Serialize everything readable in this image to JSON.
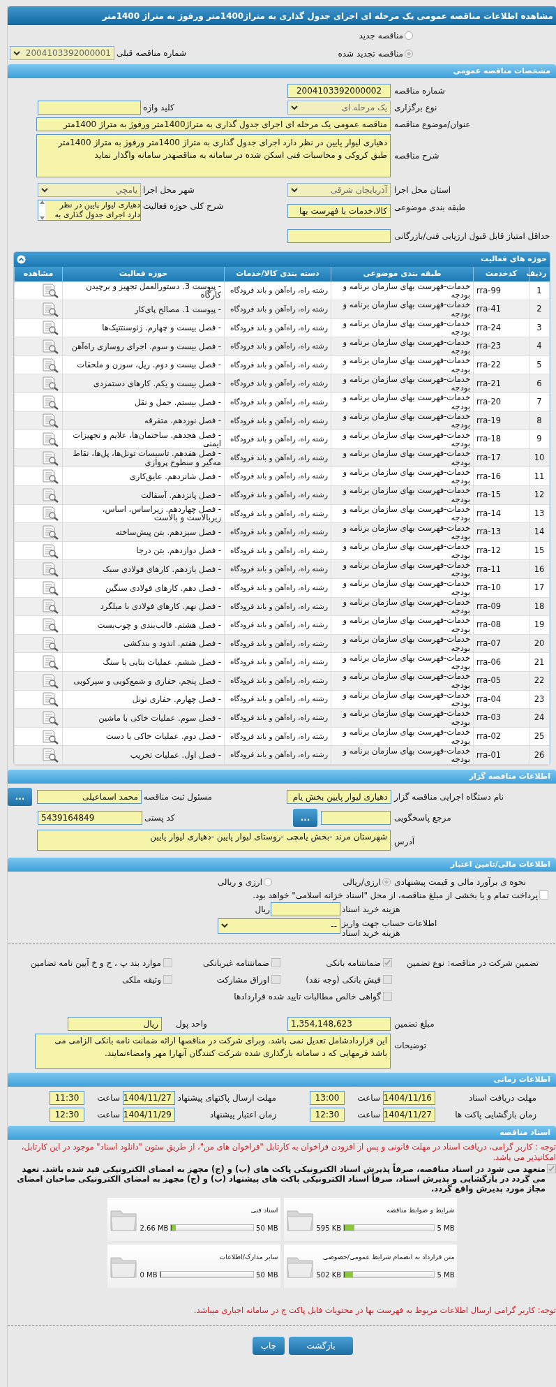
{
  "page_title": "مشاهده اطلاعات مناقصه عمومی یک مرحله ای اجرای جدول گذاری به متراژ1400متر ورفوژ به متراژ 1400متر",
  "tender_type": [
    {
      "label": "مناقصه جدید",
      "selected": false
    },
    {
      "label": "مناقصه تجدید شده",
      "selected": true
    }
  ],
  "previous_tender": {
    "label": "شماره مناقصه قبلی",
    "value": "2004103392000001"
  },
  "general": {
    "title": "مشخصات مناقصه عمومی",
    "tender_number": {
      "label": "شماره مناقصه",
      "value": "2004103392000002"
    },
    "holding_type": {
      "label": "نوع برگزاری",
      "value": "یک مرحله ای"
    },
    "keyword": {
      "label": "کلید واژه"
    },
    "subject": {
      "label": "عنوان/موضوع مناقصه",
      "value": "مناقصه عمومی یک مرحله ای اجرای جدول گذاری به متراژ1400متر ورفوژ به متراژ 1400متر"
    },
    "description": {
      "label": "شرح مناقصه",
      "value": "دهیاری لیوار پایین در نظر دارد اجرای جدول گذاری به متراژ 1400متر ورفوژ به متراژ 1400متر طبق کروکی و محاسبات فنی اسکن شده در سامانه به مناقصهدر سامانه  واگذار نماید"
    },
    "province": {
      "label": "استان محل اجرا",
      "value": "آذربایجان شرقی"
    },
    "city": {
      "label": "شهر محل اجرا",
      "value": "یامچي"
    },
    "category": {
      "label": "طبقه بندی موضوعی",
      "value": "کالا،خدمات با فهرست بها"
    },
    "activity_summary": {
      "label": "شرح کلی حوزه فعالیت",
      "value": "دهیاری لیوار پایین در نظر دارد اجرای جدول گذاری به"
    },
    "min_score": {
      "label": "حداقل امتیاز قابل قبول ارزیابی فنی/بازرگانی"
    }
  },
  "activities": {
    "title": "حوزه های فعالیت",
    "columns": [
      "ردیف",
      "کدخدمت",
      "طبقه بندی موضوعی",
      "دسته بندی کالا/خدمات",
      "حوزه فعالیت",
      "مشاهده"
    ],
    "rows": [
      {
        "index": "1",
        "code": "rra-99",
        "category": "خدمات-فهرست بهای سازمان برنامه و بودجه",
        "group": "رشته راه، راه‌آهن و باند فرودگاه",
        "activity": "- پیوست 3. دستورالعمل تجهیز و برچیدن کارگاه"
      },
      {
        "index": "2",
        "code": "rra-41",
        "category": "خدمات-فهرست بهای سازمان برنامه و بودجه",
        "group": "رشته راه، راه‌آهن و باند فرودگاه",
        "activity": "- پیوست 1. مصالح پای‌کار"
      },
      {
        "index": "3",
        "code": "rra-24",
        "category": "خدمات-فهرست بهای سازمان برنامه و بودجه",
        "group": "رشته راه، راه‌آهن و باند فرودگاه",
        "activity": "- فصل بیست و چهارم. ژئوسنتتیک‌ها"
      },
      {
        "index": "4",
        "code": "rra-23",
        "category": "خدمات-فهرست بهای سازمان برنامه و بودجه",
        "group": "رشته راه، راه‌آهن و باند فرودگاه",
        "activity": "- فصل بیست و سوم. اجرای روسازی راه‌آهن"
      },
      {
        "index": "5",
        "code": "rra-22",
        "category": "خدمات-فهرست بهای سازمان برنامه و بودجه",
        "group": "رشته راه، راه‌آهن و باند فرودگاه",
        "activity": "- فصل بیست و دوم. ریل، سوزن و ملحقات"
      },
      {
        "index": "6",
        "code": "rra-21",
        "category": "خدمات-فهرست بهای سازمان برنامه و بودجه",
        "group": "رشته راه، راه‌آهن و باند فرودگاه",
        "activity": "- فصل بیست و یکم. کارهای دستمزدی"
      },
      {
        "index": "7",
        "code": "rra-20",
        "category": "خدمات-فهرست بهای سازمان برنامه و بودجه",
        "group": "رشته راه، راه‌آهن و باند فرودگاه",
        "activity": "- فصل بیستم. حمل و نقل"
      },
      {
        "index": "8",
        "code": "rra-19",
        "category": "خدمات-فهرست بهای سازمان برنامه و بودجه",
        "group": "رشته راه، راه‌آهن و باند فرودگاه",
        "activity": "- فصل نوزدهم. متفرقه"
      },
      {
        "index": "9",
        "code": "rra-18",
        "category": "خدمات-فهرست بهای سازمان برنامه و بودجه",
        "group": "رشته راه، راه‌آهن و باند فرودگاه",
        "activity": "- فصل هجدهم. ساختمان‌ها، علایم و تجهیزات ایمنی"
      },
      {
        "index": "10",
        "code": "rra-17",
        "category": "خدمات-فهرست بهای سازمان برنامه و بودجه",
        "group": "رشته راه، راه‌آهن و باند فرودگاه",
        "activity": "- فصل هفدهم. تاسیسات تونل‌ها، پل‌ها، نقاط مه‌گیر و سطوح پروازی"
      },
      {
        "index": "11",
        "code": "rra-16",
        "category": "خدمات-فهرست بهای سازمان برنامه و بودجه",
        "group": "رشته راه، راه‌آهن و باند فرودگاه",
        "activity": "- فصل شانزدهم. عایق‌کاری"
      },
      {
        "index": "12",
        "code": "rra-15",
        "category": "خدمات-فهرست بهای سازمان برنامه و بودجه",
        "group": "رشته راه، راه‌آهن و باند فرودگاه",
        "activity": "- فصل پانزدهم. آسفالت"
      },
      {
        "index": "13",
        "code": "rra-14",
        "category": "خدمات-فهرست بهای سازمان برنامه و بودجه",
        "group": "رشته راه، راه‌آهن و باند فرودگاه",
        "activity": "- فصل چهاردهم. زیراساس، اساس، زیربالاست  و بالاست"
      },
      {
        "index": "14",
        "code": "rra-13",
        "category": "خدمات-فهرست بهای سازمان برنامه و بودجه",
        "group": "رشته راه، راه‌آهن و باند فرودگاه",
        "activity": "- فصل سیزدهم. بتن پیش‌ساخته"
      },
      {
        "index": "15",
        "code": "rra-12",
        "category": "خدمات-فهرست بهای سازمان برنامه و بودجه",
        "group": "رشته راه، راه‌آهن و باند فرودگاه",
        "activity": "- فصل دوازدهم. بتن درجا"
      },
      {
        "index": "16",
        "code": "rra-11",
        "category": "خدمات-فهرست بهای سازمان برنامه و بودجه",
        "group": "رشته راه، راه‌آهن و باند فرودگاه",
        "activity": "- فصل یازدهم. کارهای فولادی سبک"
      },
      {
        "index": "17",
        "code": "rra-10",
        "category": "خدمات-فهرست بهای سازمان برنامه و بودجه",
        "group": "رشته راه، راه‌آهن و باند فرودگاه",
        "activity": "- فصل دهم. کارهای فولادی سنگین"
      },
      {
        "index": "18",
        "code": "rra-09",
        "category": "خدمات-فهرست بهای سازمان برنامه و بودجه",
        "group": "رشته راه، راه‌آهن و باند فرودگاه",
        "activity": "- فصل نهم. کارهای فولادی با میلگرد"
      },
      {
        "index": "19",
        "code": "rra-08",
        "category": "خدمات-فهرست بهای سازمان برنامه و بودجه",
        "group": "رشته راه، راه‌آهن و باند فرودگاه",
        "activity": "- فصل هشتم. قالب‌بندی و چوب‌بست"
      },
      {
        "index": "20",
        "code": "rra-07",
        "category": "خدمات-فهرست بهای سازمان برنامه و بودجه",
        "group": "رشته راه، راه‌آهن و باند فرودگاه",
        "activity": "- فصل هفتم. اندود و بندکشی"
      },
      {
        "index": "21",
        "code": "rra-06",
        "category": "خدمات-فهرست بهای سازمان برنامه و بودجه",
        "group": "رشته راه، راه‌آهن و باند فرودگاه",
        "activity": "- فصل ششم. عملیات بنایی با سنگ"
      },
      {
        "index": "22",
        "code": "rra-05",
        "category": "خدمات-فهرست بهای سازمان برنامه و بودجه",
        "group": "رشته راه، راه‌آهن و باند فرودگاه",
        "activity": "- فصل پنجم. حفاری و شمع‌کوبی و سپرکوبی"
      },
      {
        "index": "23",
        "code": "rra-04",
        "category": "خدمات-فهرست بهای سازمان برنامه و بودجه",
        "group": "رشته راه، راه‌آهن و باند فرودگاه",
        "activity": "- فصل چهارم. حفاری تونل"
      },
      {
        "index": "24",
        "code": "rra-03",
        "category": "خدمات-فهرست بهای سازمان برنامه و بودجه",
        "group": "رشته راه، راه‌آهن و باند فرودگاه",
        "activity": "- فصل سوم. عملیات خاکی با ماشین"
      },
      {
        "index": "25",
        "code": "rra-02",
        "category": "خدمات-فهرست بهای سازمان برنامه و بودجه",
        "group": "رشته راه، راه‌آهن و باند فرودگاه",
        "activity": "- فصل دوم. عملیات خاکی با دست"
      },
      {
        "index": "26",
        "code": "rra-01",
        "category": "خدمات-فهرست بهای سازمان برنامه و بودجه",
        "group": "رشته راه، راه‌آهن و باند فرودگاه",
        "activity": "- فصل اول. عملیات تخریب"
      }
    ]
  },
  "organizer": {
    "title": "اطلاعات مناقصه گزار",
    "org_name": {
      "label": "نام دستگاه اجرایی مناقصه گزار",
      "value": "دهیاری لیوار پایین بخش یام"
    },
    "registrar": {
      "label": "مسئول ثبت مناقصه",
      "value": "محمد اسماعیلی",
      "button": "..."
    },
    "reference": {
      "label": "مرجع پاسخگویی",
      "button": "..."
    },
    "postal_code": {
      "label": "کد پستی",
      "value": "5439164849"
    },
    "address": {
      "label": "آدرس",
      "value": "شهرستان مرند -بخش یامچی -روستای لیوار پایین -دهیاری لیوار پایین"
    }
  },
  "finance": {
    "title": "اطلاعات مالی/تامین اعتبار",
    "estimate": {
      "label": "نحوه ی برآورد مالی و قیمت پیشنهادی",
      "options": [
        {
          "label": "ارزی/ریالی",
          "selected": true
        },
        {
          "label": "ارزی و ریالی",
          "selected": false
        }
      ]
    },
    "treasury": {
      "label": "پرداخت تمام و یا بخشی از مبلغ مناقصه، از محل \"اسناد خزانه اسلامی\" خواهد بود.",
      "checked": false
    },
    "doc_cost": {
      "label": "هزینه خرید اسناد",
      "unit": "ریال"
    },
    "account": {
      "label": "اطلاعات حساب جهت واریز هزینه خرید اسناد",
      "value": "--"
    }
  },
  "guarantee": {
    "label": "تضمین شرکت در مناقصه:",
    "type_label": "نوع تضمین",
    "options": [
      {
        "label": "ضمانتنامه بانکی",
        "checked": true
      },
      {
        "label": "ضمانتنامه غیربانکی",
        "checked": false
      },
      {
        "label": "موارد بند پ ، ح و خ آیین نامه تضامین",
        "checked": false
      },
      {
        "label": "فیش بانکی (وجه نقد)",
        "checked": false
      },
      {
        "label": "اوراق مشارکت",
        "checked": false
      },
      {
        "label": "وثیقه ملکی",
        "checked": false
      },
      {
        "label": "گواهی خالص مطالبات تایید شده قراردادها",
        "checked": false
      }
    ],
    "amount": {
      "label": "مبلغ تضمین",
      "value": "1,354,148,623"
    },
    "currency": {
      "label": "واحد پول",
      "value": "ریال"
    },
    "notes": {
      "label": "توضیحات",
      "value": "این قراردادشامل تعدیل نمی باشد. وبرای شرکت در مناقصها ارائه ضمانت نامه بانکی الزامی می باشد فرمهایی که د سامانه بارگذاری شده شرکت کنندگان آنهارا مهر وامضاءنمایند."
    }
  },
  "timing": {
    "title": "اطلاعات زمانی",
    "items": [
      {
        "label": "مهلت دریافت اسناد",
        "date": "1404/11/16",
        "time_label": "ساعت",
        "time": "13:00"
      },
      {
        "label": "مهلت ارسال پاکتهای پیشنهاد",
        "date": "1404/11/27",
        "time_label": "ساعت",
        "time": "11:30"
      },
      {
        "label": "زمان بازگشایی پاکت ها",
        "date": "1404/11/27",
        "time_label": "ساعت",
        "time": "12:30"
      },
      {
        "label": "زمان اعتبار پیشنهاد",
        "date": "1404/11/29",
        "time_label": "ساعت",
        "time": "12:30"
      }
    ]
  },
  "documents": {
    "title": "اسناد مناقصه",
    "notice": "توجه : کاربر گرامی، دریافت اسناد در مهلت قانونی و پس از افزودن فراخوان به کارتابل \"فراخوان های من\"، از طریق ستون \"دانلود اسناد\" موجود در این کارتابل، امکانپذیر می باشد.",
    "commitment": {
      "text": "متعهد می شود در اسناد مناقصه، صرفاً پذیرش اسناد الکترونیکی پاکت های (ب) و (ج) مجهز به امضای الکترونیکی قید شده باشد. تعهد می گردد در بازگشایی و پذیرش اسناد، صرفاً اسناد الکترونیکی پاکت های پیشنهاد (ب) و (ج) مجهز به امضای الکترونیکی صاحبان امضای مجاز مورد پذیرش واقع گردد.",
      "checked": true
    },
    "files": [
      {
        "name": "شرایط و ضوابط مناقصه",
        "size": "595 KB",
        "max": "5 MB",
        "level": 0.116
      },
      {
        "name": "اسناد فنی",
        "size": "2.66 MB",
        "max": "50 MB",
        "level": 0.053
      },
      {
        "name": "متن قرارداد به انضمام شرایط عمومی/خصوصی",
        "size": "502 KB",
        "max": "5 MB",
        "level": 0.098
      },
      {
        "name": "سایر مدارک/اطلاعات",
        "size": "0 MB",
        "max": "50 MB",
        "level": 0
      }
    ],
    "footer_note": "توجه: کاربر گرامی ارسال اطلاعات مربوط به فهرست بها در محتویات فایل پاکت ج در سامانه اجباری میباشد."
  },
  "buttons": [
    {
      "label": "بازگشت",
      "kind": "wide"
    },
    {
      "label": "چاپ",
      "kind": "narrow"
    }
  ]
}
